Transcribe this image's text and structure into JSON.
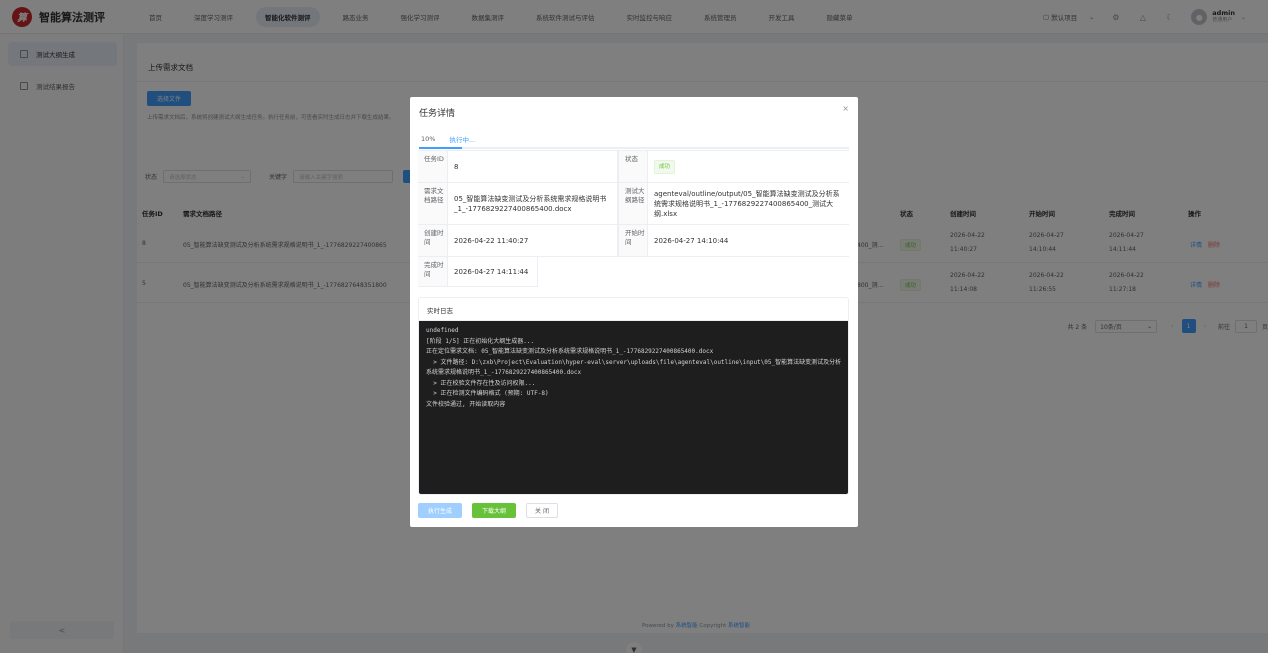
{
  "app": {
    "logo_mark": "算",
    "title": "智能算法测评"
  },
  "nav": [
    {
      "label": "首页"
    },
    {
      "label": "深度学习测评"
    },
    {
      "label": "智能化软件测评",
      "active": true
    },
    {
      "label": "路态业务"
    },
    {
      "label": "强化学习测评"
    },
    {
      "label": "数据集测评"
    },
    {
      "label": "系统软件测试与评估"
    },
    {
      "label": "实时监控与响应"
    },
    {
      "label": "系统管理员"
    },
    {
      "label": "开发工具"
    },
    {
      "label": "隐藏菜单"
    }
  ],
  "header": {
    "project": "默认项目",
    "user_name": "admin",
    "user_role": "普通用户"
  },
  "sidebar": {
    "items": [
      {
        "label": "测试大纲生成",
        "active": true
      },
      {
        "label": "测试结果报告"
      }
    ],
    "collapse": "<"
  },
  "upload": {
    "title": "上传需求文档",
    "choose_btn": "选择文件",
    "hint": "上传需求文档后，系统将创建测试大纲生成任务。执行任务前，可查看实时生成日志并下载生成结果。"
  },
  "filters": {
    "status_label": "状态",
    "status_placeholder": "请选择状态",
    "keyword_label": "关键字",
    "keyword_placeholder": "请输入关键字搜索"
  },
  "table": {
    "headers": {
      "id": "任务ID",
      "path": "需求文档路径",
      "status": "状态",
      "created": "创建时间",
      "started": "开始时间",
      "finished": "完成时间",
      "actions": "操作"
    },
    "rows": [
      {
        "id": "8",
        "path": "05_智能算法缺变测试及分析系统需求规格说明书_1_-1776829227400865",
        "path_tail": "400_测...",
        "status": "成功",
        "created_date": "2026-04-22",
        "created_time": "11:40:27",
        "started_date": "2026-04-27",
        "started_time": "14:10:44",
        "finished_date": "2026-04-27",
        "finished_time": "14:11:44",
        "detail": "详情",
        "delete": "删除"
      },
      {
        "id": "5",
        "path": "05_智能算法缺变测试及分析系统需求规格说明书_1_-1776827648351800",
        "path_tail": "800_测...",
        "status": "成功",
        "created_date": "2026-04-22",
        "created_time": "11:14:08",
        "started_date": "2026-04-22",
        "started_time": "11:26:55",
        "finished_date": "2026-04-22",
        "finished_time": "11:27:18",
        "detail": "详情",
        "delete": "删除"
      }
    ]
  },
  "pager": {
    "total": "共 2 条",
    "page_size": "10条/页",
    "current": "1",
    "goto_label": "前往",
    "goto_value": "1",
    "page_unit": "页"
  },
  "footer": {
    "powered_by": "Powered by",
    "powered_link": "系统智能",
    "copyright": "Copyright",
    "copyright_link": "系统智能"
  },
  "dialog": {
    "title": "任务详情",
    "progress_percent": "10%",
    "progress_value": 10,
    "progress_status": "执行中...",
    "fields": {
      "task_id_label": "任务ID",
      "task_id": "8",
      "status_label": "状态",
      "status": "成功",
      "req_path_label": "需求文档路径",
      "req_path": "05_智能算法缺变测试及分析系统需求规格说明书_1_-1776829227400865400.docx",
      "outline_path_label": "测试大纲路径",
      "outline_path": "agenteval/outline/output/05_智能算法缺变测试及分析系统需求规格说明书_1_-1776829227400865400_测试大纲.xlsx",
      "created_label": "创建时间",
      "created": "2026-04-22 11:40:27",
      "started_label": "开始时间",
      "started": "2026-04-27 14:10:44",
      "finished_label": "完成时间",
      "finished": "2026-04-27 14:11:44"
    },
    "log_title": "实时日志",
    "log_lines": [
      "undefined",
      "[阶段 1/5] 正在初始化大纲生成器...",
      "正在定位需求文档: 05_智能算法缺变测试及分析系统需求规格说明书_1_-1776829227400865400.docx",
      "  > 文件路径: D:\\zxb\\Project\\Evaluation\\hyper-eval\\server\\uploads\\file\\agenteval\\outline\\input\\05_智能算法缺变测试及分析系统需求规格说明书_1_-1776829227400865400.docx",
      "  > 正在校验文件存在性及访问权限...",
      "  > 正在检测文件编码格式 (预期: UTF-8)",
      "文件校验通过, 开始读取内容"
    ],
    "btn_run": "执行生成",
    "btn_download": "下载大纲",
    "btn_close": "关 闭"
  }
}
